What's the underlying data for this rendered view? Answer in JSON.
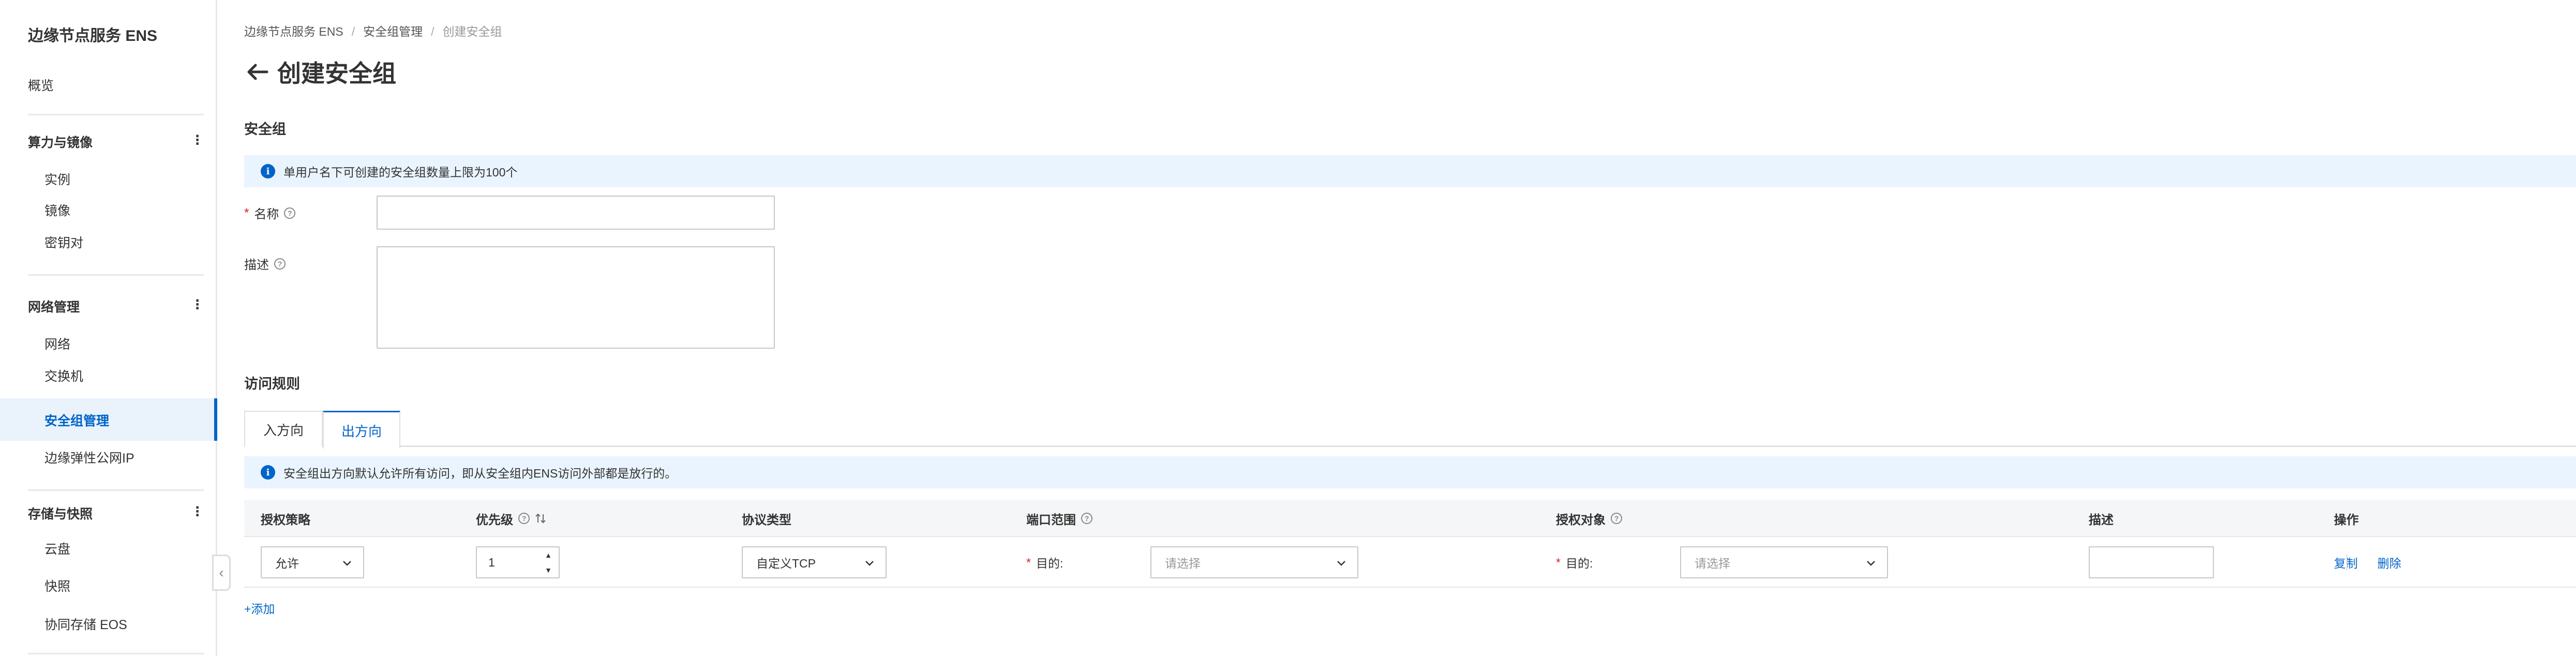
{
  "sidebar": {
    "title": "边缘节点服务 ENS",
    "overview": "概览",
    "groups": [
      {
        "label": "算力与镜像",
        "dots": "⋮",
        "items": [
          "实例",
          "镜像",
          "密钥对"
        ]
      },
      {
        "label": "网络管理",
        "dots": "⋮",
        "items": [
          "网络",
          "交换机",
          "安全组管理",
          "边缘弹性公网IP"
        ]
      },
      {
        "label": "存储与快照",
        "dots": "⋮",
        "items": [
          "云盘",
          "快照",
          "协同存储 EOS"
        ]
      }
    ],
    "active_item": "安全组管理",
    "collapse_icon": "chevron-left-icon"
  },
  "breadcrumb": [
    "边缘节点服务 ENS",
    "安全组管理",
    "创建安全组"
  ],
  "breadcrumb_sep": "/",
  "page": {
    "title": "创建安全组",
    "back_icon": "arrow-left-icon"
  },
  "security_group": {
    "section_title": "安全组",
    "notice": "单用户名下可创建的安全组数量上限为100个",
    "name_label": "名称",
    "name_required": "*",
    "name_value": "",
    "desc_label": "描述",
    "desc_value": ""
  },
  "rules": {
    "section_title": "访问规则",
    "tabs": [
      "入方向",
      "出方向"
    ],
    "active_tab": "出方向",
    "notice": "安全组出方向默认允许所有访问，即从安全组内ENS访问外部都是放行的。",
    "columns": {
      "policy": "授权策略",
      "priority": "优先级",
      "protocol": "协议类型",
      "port_range": "端口范围",
      "target": "授权对象",
      "description": "描述",
      "actions": "操作"
    },
    "rows": [
      {
        "policy": "允许",
        "priority": "1",
        "protocol": "自定义TCP",
        "port_label": "目的:",
        "port_placeholder": "请选择",
        "target_label": "目的:",
        "target_placeholder": "请选择",
        "description": "",
        "copy": "复制",
        "delete": "删除"
      }
    ],
    "add_label": "+添加"
  },
  "colors": {
    "accent": "#0064c8",
    "notice_bg": "#eaf4fe",
    "required": "#e02020"
  }
}
